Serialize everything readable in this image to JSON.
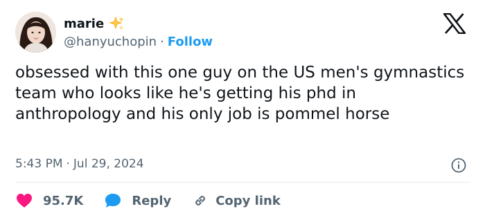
{
  "tweet": {
    "author_name": "marie",
    "handle": "@hanyuchopin",
    "separator": "·",
    "follow_label": "Follow",
    "text": "obsessed with this one guy on the US men's gymnastics team who looks like he's getting his phd in anthropology and his only job is pommel horse",
    "time": "5:43 PM",
    "date": "Jul 29, 2024"
  },
  "actions": {
    "likes_count": "95.7K",
    "reply_label": "Reply",
    "copy_link_label": "Copy link"
  },
  "colors": {
    "accent": "#1d9bf0",
    "like": "#f91880",
    "text": "#0f1419",
    "muted": "#536471"
  },
  "icons": [
    "avatar",
    "sparkle-icon",
    "x-logo-icon",
    "info-icon",
    "heart-icon",
    "reply-bubble-icon",
    "link-icon"
  ]
}
